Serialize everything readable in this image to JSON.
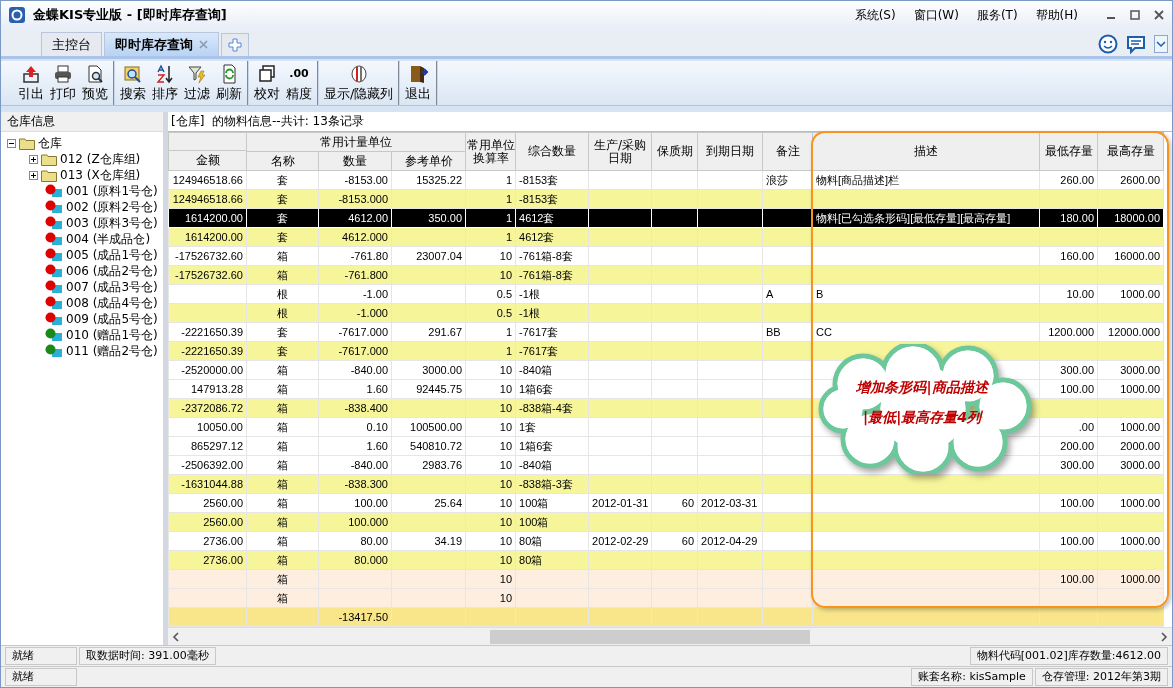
{
  "window": {
    "title": "金蝶KIS专业版 - [即时库存查询]"
  },
  "menu": [
    {
      "label": "系统(S)"
    },
    {
      "label": "窗口(W)"
    },
    {
      "label": "服务(T)"
    },
    {
      "label": "帮助(H)"
    }
  ],
  "tabs": [
    {
      "label": "主控台",
      "selected": false,
      "closable": false
    },
    {
      "label": "即时库存查询",
      "selected": true,
      "closable": true
    }
  ],
  "toolbar": [
    {
      "items": [
        {
          "label": "引出"
        },
        {
          "label": "打印"
        },
        {
          "label": "预览"
        }
      ]
    },
    {
      "items": [
        {
          "label": "搜索"
        },
        {
          "label": "排序"
        },
        {
          "label": "过滤"
        },
        {
          "label": "刷新"
        }
      ]
    },
    {
      "items": [
        {
          "label": "校对"
        },
        {
          "label": "精度",
          "icon_text": ".00"
        }
      ]
    },
    {
      "items": [
        {
          "label": "显示/隐藏列"
        }
      ]
    },
    {
      "items": [
        {
          "label": "退出"
        }
      ]
    }
  ],
  "sidebar": {
    "title": "仓库信息",
    "tree": {
      "label": "仓库",
      "expanded": true,
      "children": [
        {
          "label": "012 (Z仓库组)",
          "kind": "group",
          "expanded": false
        },
        {
          "label": "013 (X仓库组)",
          "kind": "group",
          "expanded": false
        },
        {
          "label": "001 (原料1号仓)",
          "kind": "warehouse",
          "color": "#e00000"
        },
        {
          "label": "002 (原料2号仓)",
          "kind": "warehouse",
          "color": "#e00000"
        },
        {
          "label": "003 (原料3号仓)",
          "kind": "warehouse",
          "color": "#e00000"
        },
        {
          "label": "004 (半成品仓)",
          "kind": "warehouse",
          "color": "#e00000"
        },
        {
          "label": "005 (成品1号仓)",
          "kind": "warehouse",
          "color": "#e00000"
        },
        {
          "label": "006 (成品2号仓)",
          "kind": "warehouse",
          "color": "#e00000"
        },
        {
          "label": "007 (成品3号仓)",
          "kind": "warehouse",
          "color": "#e00000"
        },
        {
          "label": "008 (成品4号仓)",
          "kind": "warehouse",
          "color": "#e00000"
        },
        {
          "label": "009 (成品5号仓)",
          "kind": "warehouse",
          "color": "#e00000"
        },
        {
          "label": "010 (赠品1号仓)",
          "kind": "warehouse",
          "color": "#1a8a1a"
        },
        {
          "label": "011 (赠品2号仓)",
          "kind": "warehouse",
          "color": "#1a8a1a"
        }
      ]
    }
  },
  "table": {
    "caption": "[仓库]  的物料信息--共计: 13条记录",
    "columns": [
      {
        "label": "金额"
      },
      {
        "label": "常用计量单位",
        "colspan": 3,
        "children": [
          {
            "label": "名称"
          },
          {
            "label": "数量"
          },
          {
            "label": "参考单价"
          }
        ]
      },
      {
        "label": "常用单位换算率"
      },
      {
        "label": "综合数量"
      },
      {
        "label": "生产/采购日期"
      },
      {
        "label": "保质期"
      },
      {
        "label": "到期日期"
      },
      {
        "label": "备注"
      },
      {
        "label": "描述"
      },
      {
        "label": "最低存量"
      },
      {
        "label": "最高存量"
      }
    ],
    "rows": [
      {
        "kind": "normal",
        "selected": false,
        "cells": [
          "124946518.66",
          "套",
          "-8153.00",
          "15325.22",
          "1",
          "-8153套",
          null,
          null,
          null,
          "浪莎",
          "物料[商品描述]栏",
          "260.00",
          "2600.00"
        ]
      },
      {
        "kind": "subtotal",
        "selected": false,
        "cells": [
          "124946518.66",
          "套",
          "-8153.000",
          null,
          "1",
          "-8153套",
          null,
          null,
          null,
          null,
          null,
          null,
          null
        ]
      },
      {
        "kind": "normal",
        "selected": true,
        "cells": [
          "1614200.00",
          "套",
          "4612.00",
          "350.00",
          "1",
          "4612套",
          null,
          null,
          null,
          null,
          "物料[已勾选条形码][最低存量][最高存量]",
          "180.00",
          "18000.00"
        ]
      },
      {
        "kind": "subtotal",
        "selected": false,
        "cells": [
          "1614200.00",
          "套",
          "4612.000",
          null,
          "1",
          "4612套",
          null,
          null,
          null,
          null,
          null,
          null,
          null
        ]
      },
      {
        "kind": "normal",
        "selected": false,
        "cells": [
          "-17526732.60",
          "箱",
          "-761.80",
          "23007.04",
          "10",
          "-761箱-8套",
          null,
          null,
          null,
          null,
          null,
          "160.00",
          "16000.00"
        ]
      },
      {
        "kind": "subtotal",
        "selected": false,
        "cells": [
          "-17526732.60",
          "箱",
          "-761.800",
          null,
          "10",
          "-761箱-8套",
          null,
          null,
          null,
          null,
          null,
          null,
          null
        ]
      },
      {
        "kind": "normal",
        "selected": false,
        "cells": [
          null,
          "根",
          "-1.00",
          null,
          "0.5",
          "-1根",
          null,
          null,
          null,
          "A",
          "B",
          "10.00",
          "1000.00"
        ]
      },
      {
        "kind": "subtotal",
        "selected": false,
        "cells": [
          null,
          "根",
          "-1.000",
          null,
          "0.5",
          "-1根",
          null,
          null,
          null,
          null,
          null,
          null,
          null
        ]
      },
      {
        "kind": "normal",
        "selected": false,
        "cells": [
          "-2221650.39",
          "套",
          "-7617.000",
          "291.67",
          "1",
          "-7617套",
          null,
          null,
          null,
          "BB",
          "CC",
          "1200.000",
          "12000.000"
        ]
      },
      {
        "kind": "subtotal",
        "selected": false,
        "cells": [
          "-2221650.39",
          "套",
          "-7617.000",
          null,
          "1",
          "-7617套",
          null,
          null,
          null,
          null,
          null,
          null,
          null
        ]
      },
      {
        "kind": "normal",
        "selected": false,
        "cells": [
          "-2520000.00",
          "箱",
          "-840.00",
          "3000.00",
          "10",
          "-840箱",
          null,
          null,
          null,
          null,
          null,
          "300.00",
          "3000.00"
        ]
      },
      {
        "kind": "normal",
        "selected": false,
        "cells": [
          "147913.28",
          "箱",
          "1.60",
          "92445.75",
          "10",
          "1箱6套",
          null,
          null,
          null,
          null,
          null,
          "100.00",
          "1000.00"
        ]
      },
      {
        "kind": "subtotal",
        "selected": false,
        "cells": [
          "-2372086.72",
          "箱",
          "-838.400",
          null,
          "10",
          "-838箱-4套",
          null,
          null,
          null,
          null,
          null,
          null,
          null
        ]
      },
      {
        "kind": "normal",
        "selected": false,
        "cells": [
          "10050.00",
          "箱",
          "0.10",
          "100500.00",
          "10",
          "1套",
          null,
          null,
          null,
          null,
          null,
          ".00",
          "1000.00"
        ]
      },
      {
        "kind": "normal",
        "selected": false,
        "cells": [
          "865297.12",
          "箱",
          "1.60",
          "540810.72",
          "10",
          "1箱6套",
          null,
          null,
          null,
          null,
          null,
          "200.00",
          "2000.00"
        ]
      },
      {
        "kind": "normal",
        "selected": false,
        "cells": [
          "-2506392.00",
          "箱",
          "-840.00",
          "2983.76",
          "10",
          "-840箱",
          null,
          null,
          null,
          null,
          null,
          "300.00",
          "3000.00"
        ]
      },
      {
        "kind": "subtotal",
        "selected": false,
        "cells": [
          "-1631044.88",
          "箱",
          "-838.300",
          null,
          "10",
          "-838箱-3套",
          null,
          null,
          null,
          null,
          null,
          null,
          null
        ]
      },
      {
        "kind": "normal",
        "selected": false,
        "cells": [
          "2560.00",
          "箱",
          "100.00",
          "25.64",
          "10",
          "100箱",
          "2012-01-31",
          "60",
          "2012-03-31",
          null,
          null,
          "100.00",
          "1000.00"
        ]
      },
      {
        "kind": "subtotal",
        "selected": false,
        "cells": [
          "2560.00",
          "箱",
          "100.000",
          null,
          "10",
          "100箱",
          null,
          null,
          null,
          null,
          null,
          null,
          null
        ]
      },
      {
        "kind": "normal",
        "selected": false,
        "cells": [
          "2736.00",
          "箱",
          "80.00",
          "34.19",
          "10",
          "80箱",
          "2012-02-29",
          "60",
          "2012-04-29",
          null,
          null,
          "100.00",
          "1000.00"
        ]
      },
      {
        "kind": "subtotal",
        "selected": false,
        "cells": [
          "2736.00",
          "箱",
          "80.000",
          null,
          "10",
          "80箱",
          null,
          null,
          null,
          null,
          null,
          null,
          null
        ]
      },
      {
        "kind": "blank",
        "selected": false,
        "cells": [
          null,
          "箱",
          null,
          null,
          "10",
          null,
          null,
          null,
          null,
          null,
          null,
          "100.00",
          "1000.00"
        ]
      },
      {
        "kind": "blank",
        "selected": false,
        "cells": [
          null,
          "箱",
          null,
          null,
          "10",
          null,
          null,
          null,
          null,
          null,
          null,
          null,
          null
        ]
      },
      {
        "kind": "total",
        "selected": false,
        "cells": [
          null,
          null,
          "-13417.50",
          null,
          null,
          null,
          null,
          null,
          null,
          null,
          null,
          null,
          null
        ]
      }
    ]
  },
  "callout": {
    "lines": [
      "增加条形码|商品描述",
      "|最低|最高存量4列"
    ]
  },
  "status_bars": [
    {
      "left": [
        "就绪",
        "取数据时间: 391.00毫秒"
      ],
      "right": [
        "物料代码[001.02]库存数量:4612.00"
      ]
    },
    {
      "left": [
        "就绪"
      ],
      "right": [
        "账套名称: kisSample",
        "仓存管理: 2012年第3期"
      ]
    }
  ]
}
